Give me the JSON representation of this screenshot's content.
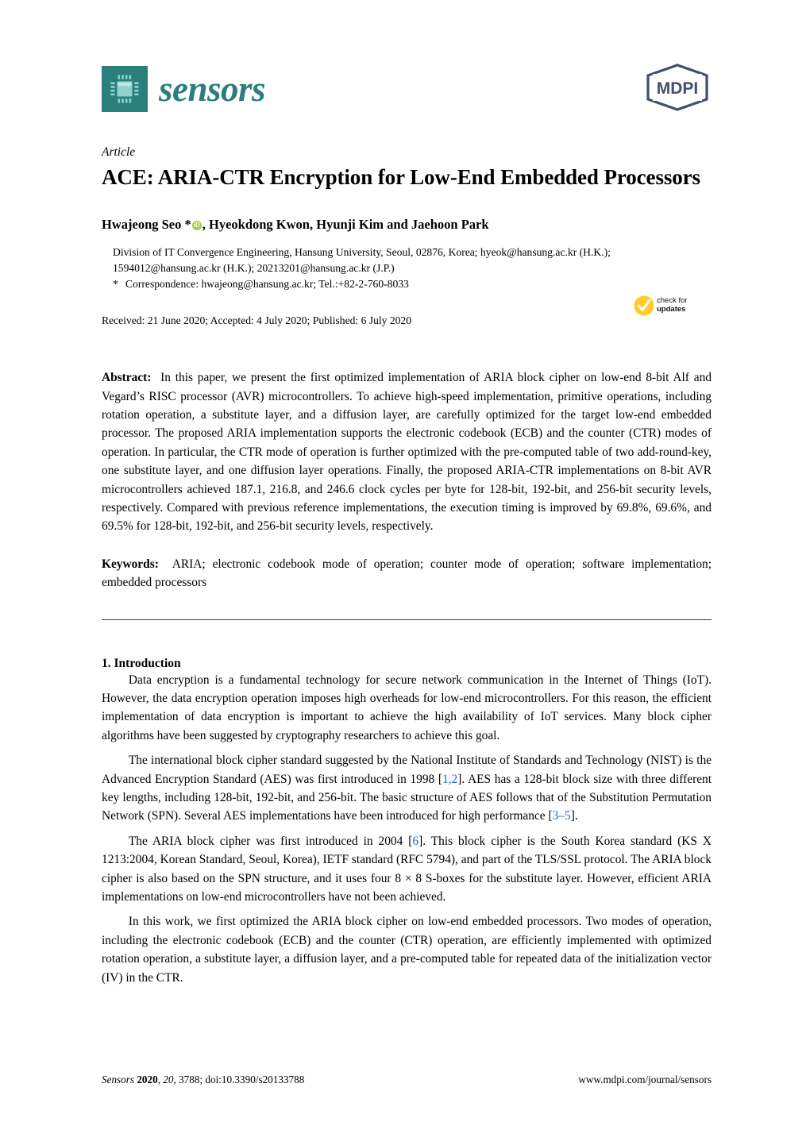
{
  "journal": {
    "name": "sensors",
    "logo_color": "#2b7e7e",
    "chip_icon": "microchip-icon",
    "publisher_logo": "mdpi-logo",
    "publisher_name": "MDPI",
    "publisher_color": "#414e6e"
  },
  "article": {
    "type_label": "Article",
    "title": "ACE: ARIA-CTR Encryption for Low-End Embedded Processors",
    "authors_line": "Hwajeong Seo *",
    "authors_rest": ", Hyeokdong Kwon, Hyunji Kim and Jaehoon Park",
    "orcid_label": "iD",
    "affiliation": "Division of IT Convergence Engineering, Hansung University, Seoul, 02876, Korea; hyeok@hansung.ac.kr (H.K.); 1594012@hansung.ac.kr (H.K.); 20213201@hansung.ac.kr (J.P.)",
    "correspondence_marker": "*",
    "correspondence": "Correspondence: hwajeong@hansung.ac.kr; Tel.:+82-2-760-8033",
    "dates": "Received: 21 June 2020; Accepted: 4 July 2020; Published: 6 July 2020"
  },
  "crossmark": {
    "icon": "check-mark-icon",
    "line1": "check for",
    "line2": "updates",
    "color": "#ffcc2a"
  },
  "abstract": {
    "label": "Abstract:",
    "text": "In this paper, we present the first optimized implementation of ARIA block cipher on low-end 8-bit Alf and Vegard’s RISC processor (AVR) microcontrollers.  To achieve high-speed implementation, primitive operations, including rotation operation, a substitute layer, and a diffusion layer, are carefully optimized for the target low-end embedded processor.  The proposed ARIA implementation supports the electronic codebook (ECB) and the counter (CTR) modes of operation. In particular, the CTR mode of operation is further optimized with the pre-computed table of two add-round-key, one substitute layer, and one diffusion layer operations.  Finally, the proposed ARIA-CTR implementations on 8-bit AVR microcontrollers achieved 187.1, 216.8, and 246.6 clock cycles per byte for 128-bit, 192-bit, and 256-bit security levels, respectively. Compared with previous reference implementations, the execution timing is improved by 69.8%, 69.6%, and 69.5% for 128-bit, 192-bit, and 256-bit security levels, respectively."
  },
  "keywords": {
    "label": "Keywords:",
    "text": "ARIA; electronic codebook mode of operation; counter mode of operation; software implementation; embedded processors"
  },
  "sections": [
    {
      "heading": "1. Introduction",
      "paragraphs": [
        {
          "parts": [
            {
              "t": "Data encryption is a fundamental technology for secure network communication in the Internet of Things (IoT). However, the data encryption operation imposes high overheads for low-end microcontrollers.  For this reason, the efficient implementation of data encryption is important to achieve the high availability of IoT services. Many block cipher algorithms have been suggested by cryptography researchers to achieve this goal."
            }
          ]
        },
        {
          "parts": [
            {
              "t": "The international block cipher standard suggested by the National Institute of Standards and Technology (NIST) is the Advanced Encryption Standard (AES) was first introduced in 1998 ["
            },
            {
              "t": "1,2",
              "cite": true
            },
            {
              "t": "]. AES has a 128-bit block size with three different key lengths, including 128-bit, 192-bit, and 256-bit. The basic structure of AES follows that of the Substitution Permutation Network (SPN). Several AES implementations have been introduced for high performance ["
            },
            {
              "t": "3–5",
              "cite": true
            },
            {
              "t": "]."
            }
          ]
        },
        {
          "parts": [
            {
              "t": "The ARIA block cipher was first introduced in 2004 ["
            },
            {
              "t": "6",
              "cite": true
            },
            {
              "t": "].  This block cipher is the South Korea standard (KS X 1213:2004, Korean Standard, Seoul, Korea), IETF standard (RFC 5794), and part of the TLS/SSL protocol. The ARIA block cipher is also based on the SPN structure, and it uses four 8 × 8 S-boxes for the substitute layer. However, efficient ARIA implementations on low-end microcontrollers have not been achieved."
            }
          ]
        },
        {
          "parts": [
            {
              "t": "In this work, we first optimized the ARIA block cipher on low-end embedded processors. Two modes of operation, including the electronic codebook (ECB) and the counter (CTR) operation, are efficiently implemented with optimized rotation operation, a substitute layer, a diffusion layer, and a pre-computed table for repeated data of the initialization vector (IV) in the CTR."
            }
          ]
        }
      ]
    }
  ],
  "footer": {
    "journal_italic": "Sensors",
    "year": "2020",
    "volume": "20",
    "rest": ", 3788; doi:10.3390/s20133788",
    "url": "www.mdpi.com/journal/sensors"
  }
}
